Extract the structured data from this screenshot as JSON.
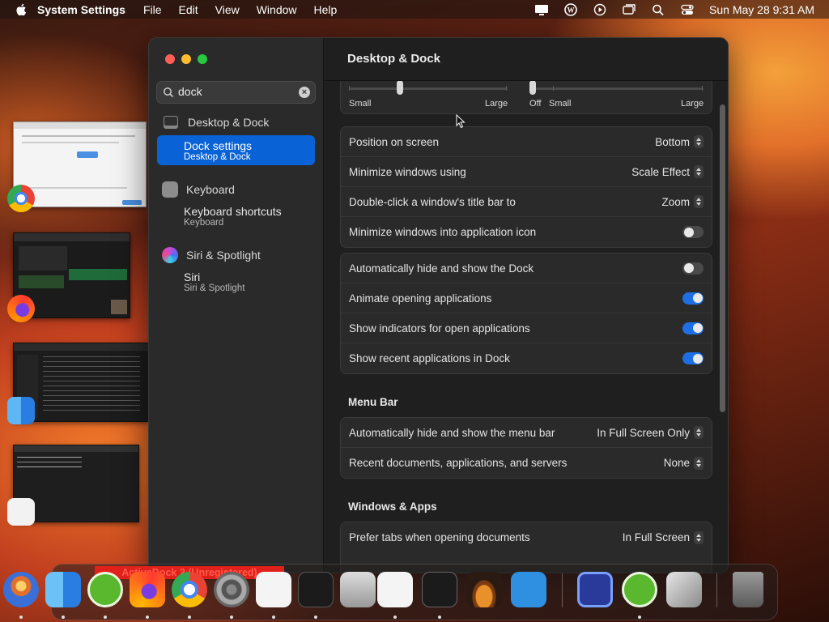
{
  "menubar": {
    "app_name": "System Settings",
    "menus": [
      "File",
      "Edit",
      "View",
      "Window",
      "Help"
    ],
    "clock": "Sun May 28  9:31 AM"
  },
  "sidebar": {
    "search_value": "dock",
    "groups": [
      {
        "label": "Desktop & Dock",
        "sub_title": "Dock settings",
        "sub_caption": "Desktop & Dock"
      },
      {
        "label": "Keyboard",
        "sub_title": "Keyboard shortcuts",
        "sub_caption": "Keyboard"
      },
      {
        "label": "Siri & Spotlight",
        "sub_title": "Siri",
        "sub_caption": "Siri & Spotlight"
      }
    ]
  },
  "main": {
    "title": "Desktop & Dock",
    "size_slider": {
      "min_label": "Small",
      "max_label": "Large",
      "value_fraction": 0.3
    },
    "magnification_slider": {
      "off_label": "Off",
      "min_label": "Small",
      "max_label": "Large",
      "value_fraction": 0.0
    },
    "dock_rows": [
      {
        "label": "Position on screen",
        "value": "Bottom"
      },
      {
        "label": "Minimize windows using",
        "value": "Scale Effect"
      },
      {
        "label": "Double-click a window's title bar to",
        "value": "Zoom"
      },
      {
        "label": "Minimize windows into application icon",
        "toggle": false
      }
    ],
    "dock_toggles": [
      {
        "label": "Automatically hide and show the Dock",
        "toggle": false
      },
      {
        "label": "Animate opening applications",
        "toggle": true
      },
      {
        "label": "Show indicators for open applications",
        "toggle": true
      },
      {
        "label": "Show recent applications in Dock",
        "toggle": true
      }
    ],
    "menu_bar_section": "Menu Bar",
    "menu_bar_rows": [
      {
        "label": "Automatically hide and show the menu bar",
        "value": "In Full Screen Only"
      },
      {
        "label": "Recent documents, applications, and servers",
        "value": "None"
      }
    ],
    "windows_section": "Windows & Apps",
    "windows_rows": [
      {
        "label": "Prefer tabs when opening documents",
        "value": "In Full Screen"
      }
    ]
  },
  "dock": {
    "banner": "ActiveDock 2 (Unregistered)"
  },
  "colors": {
    "accent": "#0a63d6",
    "toggle_on": "#1e6ee6",
    "close": "#ff5f57",
    "minimize": "#febc2e",
    "zoom": "#28c840"
  }
}
